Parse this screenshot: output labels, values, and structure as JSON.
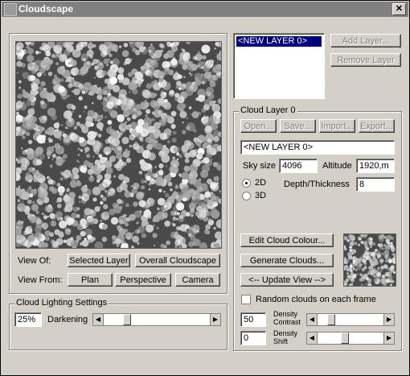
{
  "window": {
    "title": "Cloudscape",
    "close_label": "✕"
  },
  "preview_panel": {
    "view_of_label": "View Of:",
    "selected_layer_btn": "Selected Layer",
    "overall_cloudscape_btn": "Overall Cloudscape",
    "view_from_label": "View From:",
    "plan_btn": "Plan",
    "perspective_btn": "Perspective",
    "camera_btn": "Camera"
  },
  "lighting": {
    "title": "Cloud Lighting Settings",
    "value": "25%",
    "label": "Darkening",
    "slider_level": 0.2
  },
  "layers": {
    "items": [
      "<NEW LAYER 0>"
    ],
    "add_btn": "Add Layer...",
    "remove_btn": "Remove Layer"
  },
  "cloud_layer": {
    "title": "Cloud Layer 0",
    "open_btn": "Open...",
    "save_btn": "Save...",
    "import_btn": "Import...",
    "export_btn": "Export...",
    "name_value": "<NEW LAYER 0>",
    "sky_size_label": "Sky size",
    "sky_size_value": "4096",
    "altitude_label": "Altitude",
    "altitude_value": "1920,m",
    "mode_2d": "2D",
    "mode_3d": "3D",
    "depth_label": "Depth/Thickness",
    "depth_value": "8",
    "edit_colour_btn": "Edit Cloud Colour...",
    "generate_btn": "Generate Clouds...",
    "update_btn": "<-- Update View -->",
    "random_label": "Random clouds on each frame",
    "density_contrast_value": "50",
    "density_contrast_label_1": "Density",
    "density_contrast_label_2": "Contrast",
    "density_contrast_level": 0.18,
    "density_shift_value": "0",
    "density_shift_label_1": "Density",
    "density_shift_label_2": "Shift",
    "density_shift_level": 0.4
  }
}
